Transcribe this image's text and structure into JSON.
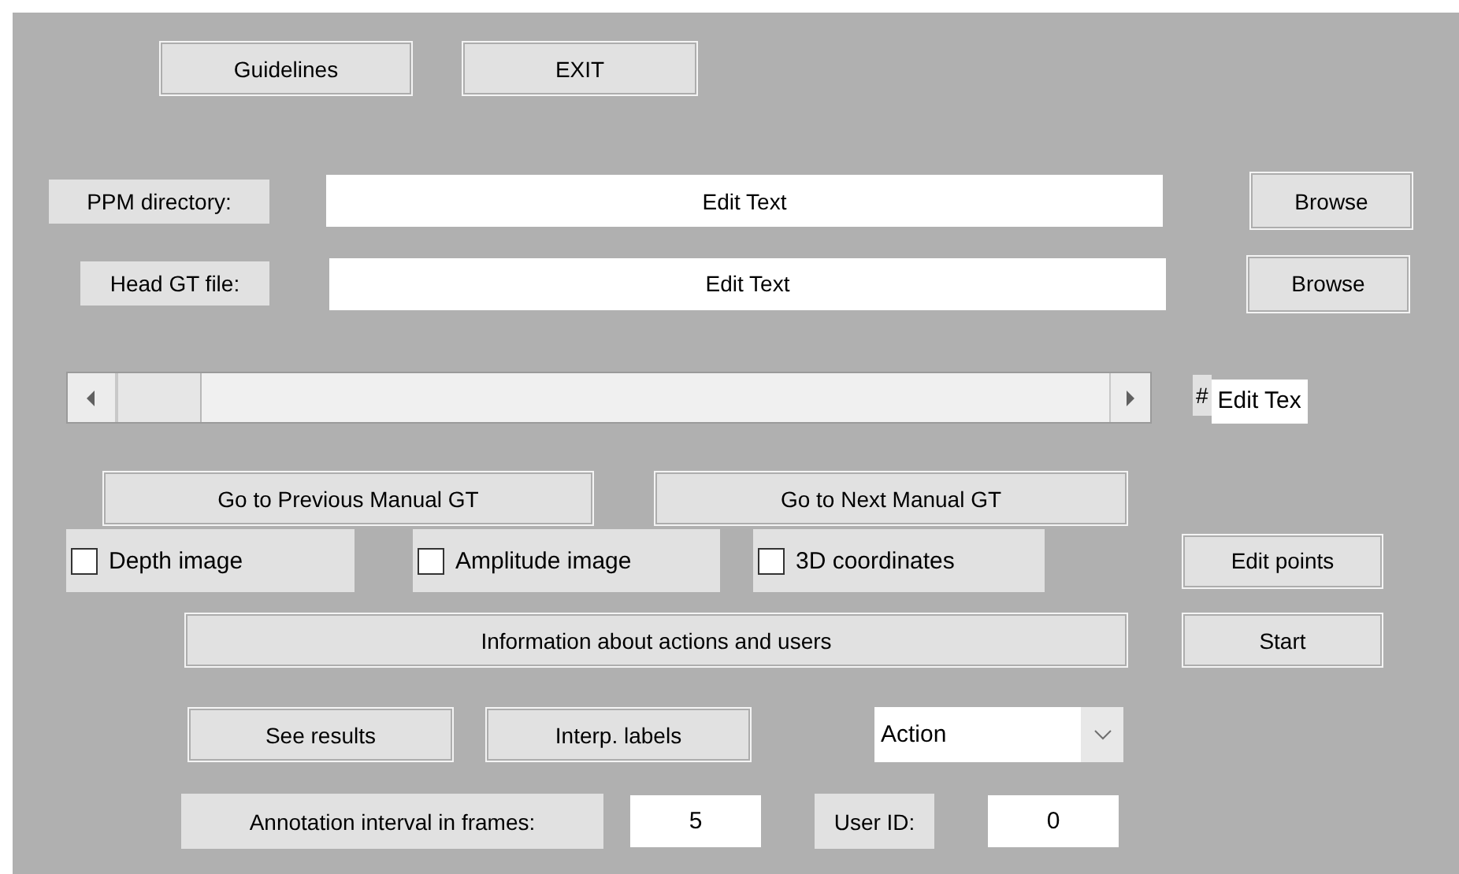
{
  "top_buttons": [
    "Guidelines",
    "EXIT"
  ],
  "path_rows": [
    {
      "label": "PPM directory:",
      "value": "Edit Text",
      "button": "Browse"
    },
    {
      "label": "Head GT file:",
      "value": "Edit Text",
      "button": "Browse"
    }
  ],
  "frame_slider": {
    "level": 0
  },
  "frame_number": {
    "label": "#",
    "value": "Edit Tex"
  },
  "nav_buttons": [
    "Go to Previous Manual GT",
    "Go to Next Manual GT"
  ],
  "checkboxes": [
    {
      "label": "Depth image",
      "checked": false
    },
    {
      "label": "Amplitude image",
      "checked": false
    },
    {
      "label": "3D coordinates",
      "checked": false
    }
  ],
  "edit_points_button": "Edit points",
  "info_button": "Information about actions and users",
  "start_button": "Start",
  "see_results_button": "See results",
  "interp_button": "Interp. labels",
  "action_dropdown": {
    "value": "Action"
  },
  "interval": {
    "label": "Annotation interval in frames:",
    "value": "5"
  },
  "user": {
    "label": "User ID:",
    "value": "0"
  }
}
